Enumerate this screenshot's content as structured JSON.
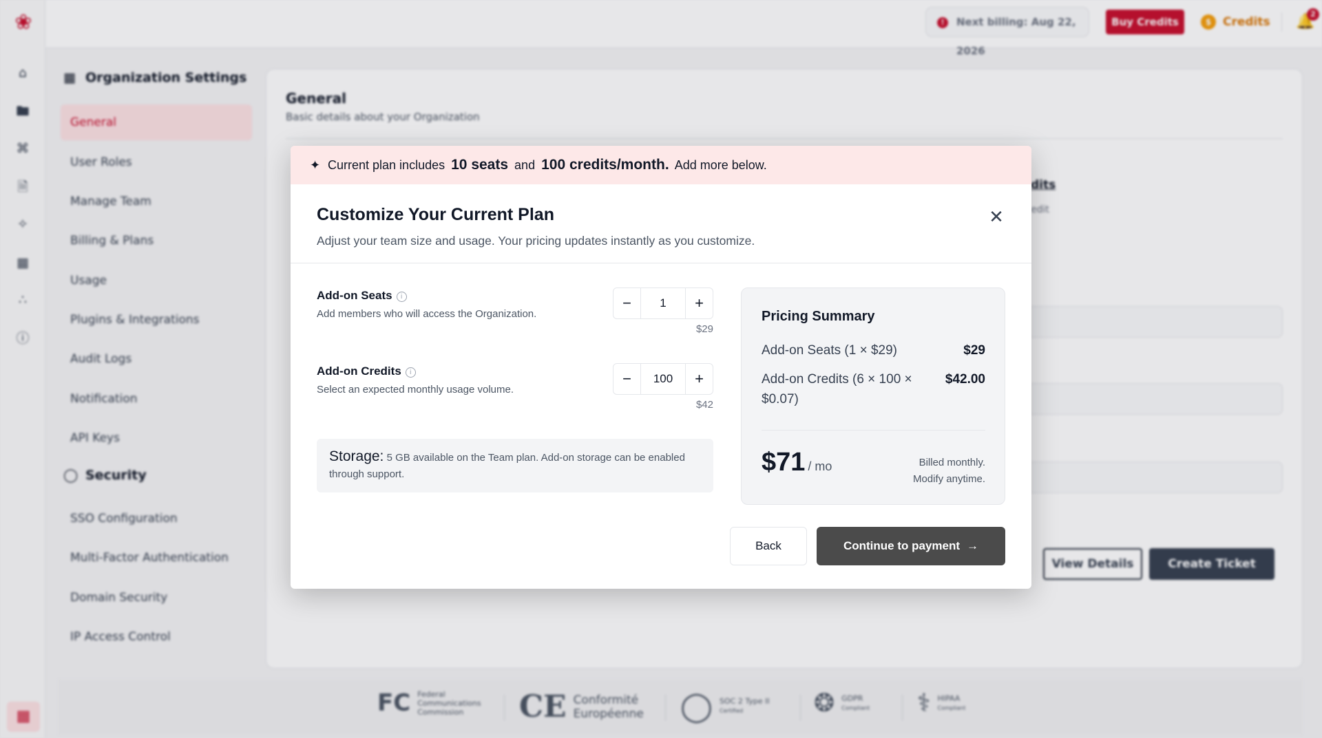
{
  "topbar": {
    "next_billing": "Next billing: Aug 22, 2026",
    "buy_credits": "Buy Credits",
    "credits": "Credits",
    "notification_count": "2"
  },
  "settings_nav": {
    "title": "Organization Settings",
    "items": [
      "General",
      "User Roles",
      "Manage Team",
      "Billing & Plans",
      "Usage",
      "Plugins & Integrations",
      "Audit Logs",
      "Notification",
      "API Keys"
    ],
    "security_title": "Security",
    "security_items": [
      "SSO Configuration",
      "Multi-Factor Authentication",
      "Domain Security",
      "IP Access Control"
    ]
  },
  "main": {
    "title": "General",
    "subtitle": "Basic details about your Organization",
    "credits_link": "dits",
    "credits_sub": "edit",
    "view_details": "View Details",
    "create_ticket": "Create Ticket"
  },
  "footer": {
    "fcc": "Federal Communications Commission",
    "ce": "Conformité Européenne",
    "soc": "SOC 2 Type II",
    "soc_sub": "Certified",
    "gdpr": "GDPR",
    "gdpr_sub": "Compliant",
    "hipaa": "HIPAA",
    "hipaa_sub": "Compliant"
  },
  "modal": {
    "banner": {
      "prefix": "Current plan includes",
      "seats": "10 seats",
      "and": "and",
      "credits": "100 credits/month.",
      "suffix": "Add more below."
    },
    "title": "Customize Your Current Plan",
    "subtitle": "Adjust your team size and usage. Your pricing updates instantly as you customize.",
    "seats": {
      "label": "Add-on Seats",
      "description": "Add members who will access the Organization.",
      "value": "1",
      "price": "$29"
    },
    "credits": {
      "label": "Add-on Credits",
      "description": "Select an expected monthly usage volume.",
      "value": "100",
      "price": "$42"
    },
    "storage": {
      "heading": "Storage:",
      "text": "5 GB available on the Team plan. Add-on storage can be enabled through support."
    },
    "summary": {
      "title": "Pricing Summary",
      "seats_line": "Add-on Seats (1 × $29)",
      "seats_value": "$29",
      "credits_line": "Add-on Credits (6 × 100 × $0.07)",
      "credits_value": "$42.00",
      "total": "$71",
      "per": "/ mo",
      "note_1": "Billed monthly.",
      "note_2": "Modify anytime."
    },
    "back": "Back",
    "continue": "Continue to payment"
  }
}
